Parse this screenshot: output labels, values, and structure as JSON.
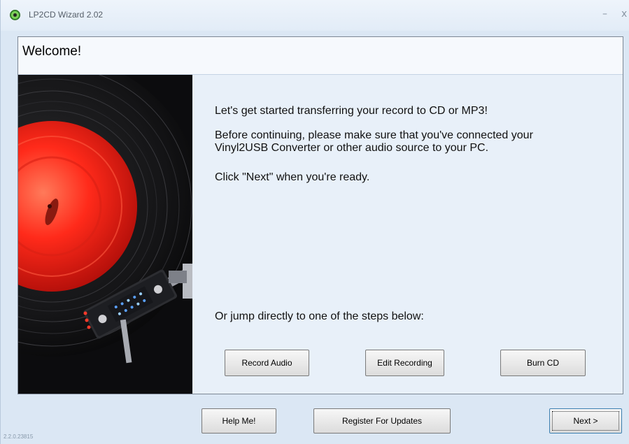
{
  "window": {
    "title": "LP2CD Wizard 2.02",
    "minimize_glyph": "–",
    "close_glyph": "x",
    "app_icon": "lp2cd-disc-icon"
  },
  "page": {
    "heading": "Welcome!",
    "intro": "Let's get started transferring your record to CD or MP3!",
    "instruction": "Before continuing, please make sure that you've connected your Vinyl2USB Converter or other audio source to your PC.",
    "ready": "Click \"Next\" when you're ready.",
    "jump": "Or jump directly to one of the steps below:"
  },
  "steps": {
    "record": "Record Audio",
    "edit": "Edit Recording",
    "burn": "Burn CD"
  },
  "footer": {
    "help": "Help Me!",
    "register": "Register For Updates",
    "next": "Next >",
    "version": "2.2.0.23815"
  },
  "colors": {
    "panel_bg": "#e8f0f9",
    "window_bg": "#dbe7f4",
    "record_label": "#ff3b2a",
    "focus_border": "#3c7fb1"
  }
}
